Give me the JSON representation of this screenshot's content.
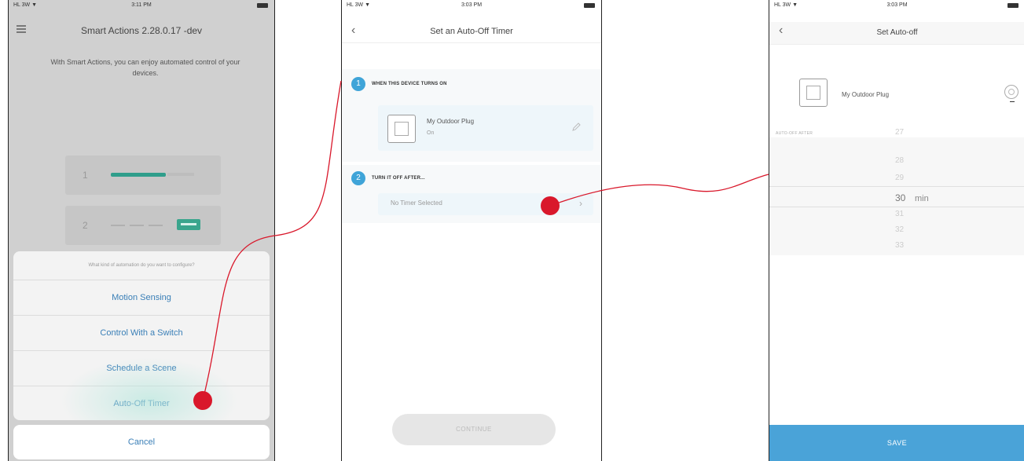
{
  "phone1": {
    "status": {
      "carrier": "HL 3W ▼",
      "time": "3:11 PM"
    },
    "title": "Smart Actions 2.28.0.17 -dev",
    "intro": "With Smart Actions, you can enjoy automated control of your devices.",
    "card1_num": "1",
    "card2_num": "2",
    "sheet": {
      "question": "What kind of automation do you want to configure?",
      "options": [
        "Motion Sensing",
        "Control With a Switch",
        "Schedule a Scene",
        "Auto-Off Timer"
      ],
      "cancel": "Cancel"
    }
  },
  "phone2": {
    "status": {
      "carrier": "HL 3W ▼",
      "time": "3:03 PM"
    },
    "title": "Set an Auto-Off Timer",
    "step1": {
      "num": "1",
      "label": "WHEN THIS DEVICE TURNS ON",
      "device_name": "My Outdoor Plug",
      "device_sub": "On"
    },
    "step2": {
      "num": "2",
      "label": "TURN IT OFF AFTER...",
      "timer_text": "No Timer Selected"
    },
    "continue": "CONTINUE"
  },
  "phone3": {
    "status": {
      "carrier": "HL 3W ▼",
      "time": "3:03 PM"
    },
    "title": "Set Auto-off",
    "device_name": "My Outdoor Plug",
    "section_label": "AUTO-OFF AFTER",
    "picker_values": [
      "27",
      "28",
      "29",
      "30",
      "31",
      "32",
      "33"
    ],
    "selected_value": "30",
    "unit": "min",
    "save": "SAVE"
  },
  "colors": {
    "accent_blue": "#4aa3d8",
    "link_blue": "#3a7fb7",
    "annotation_red": "#d9182b",
    "toggle_green": "#3aa58d"
  }
}
